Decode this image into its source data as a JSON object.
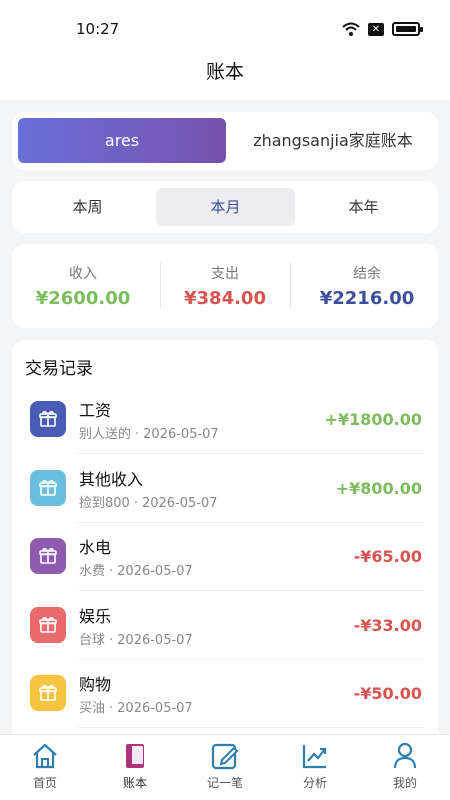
{
  "status": {
    "time": "10:27",
    "icons": [
      "wifi-icon",
      "sim-icon",
      "battery-icon"
    ]
  },
  "header": {
    "title": "账本"
  },
  "ledgers": {
    "active": "ares",
    "other": "zhangsanjia家庭账本"
  },
  "period_tabs": [
    "本周",
    "本月",
    "本年"
  ],
  "period_active_index": 1,
  "summary": [
    {
      "label": "收入",
      "value": "¥2600.00",
      "color": "#7cbc5c"
    },
    {
      "label": "支出",
      "value": "¥384.00",
      "color": "#d9534f"
    },
    {
      "label": "结余",
      "value": "¥2216.00",
      "color": "#3b4f9c"
    }
  ],
  "records": {
    "title": "交易记录",
    "items": [
      {
        "name": "工资",
        "note": "别人送的",
        "date": "2026-05-07",
        "sep": "·",
        "amount": "+¥1800.00",
        "icon": "gift-icon",
        "icon_color": "#4a5bb5",
        "amount_color": "#7cbc5c"
      },
      {
        "name": "其他收入",
        "note": "捡到800",
        "date": "2026-05-07",
        "sep": "·",
        "amount": "+¥800.00",
        "icon": "gift-icon",
        "icon_color": "#6cbfdc",
        "amount_color": "#7cbc5c"
      },
      {
        "name": "水电",
        "note": "水费",
        "date": "2026-05-07",
        "sep": "·",
        "amount": "-¥65.00",
        "icon": "gift-icon",
        "icon_color": "#8c5bb0",
        "amount_color": "#d9534f"
      },
      {
        "name": "娱乐",
        "note": "台球",
        "date": "2026-05-07",
        "sep": "·",
        "amount": "-¥33.00",
        "icon": "gift-icon",
        "icon_color": "#e96a6a",
        "amount_color": "#d9534f"
      },
      {
        "name": "购物",
        "note": "买油",
        "date": "2026-05-07",
        "sep": "·",
        "amount": "-¥50.00",
        "icon": "gift-icon",
        "icon_color": "#f5c542",
        "amount_color": "#d9534f"
      }
    ]
  },
  "tabbar": {
    "items": [
      {
        "label": "首页",
        "icon": "home-icon",
        "color": "#2e7fb0"
      },
      {
        "label": "账本",
        "icon": "book-icon",
        "color": "#b0327a"
      },
      {
        "label": "记一笔",
        "icon": "edit-icon",
        "color": "#2e7fb0"
      },
      {
        "label": "分析",
        "icon": "chart-icon",
        "color": "#2e7fb0"
      },
      {
        "label": "我的",
        "icon": "user-icon",
        "color": "#2e7fb0"
      }
    ],
    "active_index": 1
  }
}
